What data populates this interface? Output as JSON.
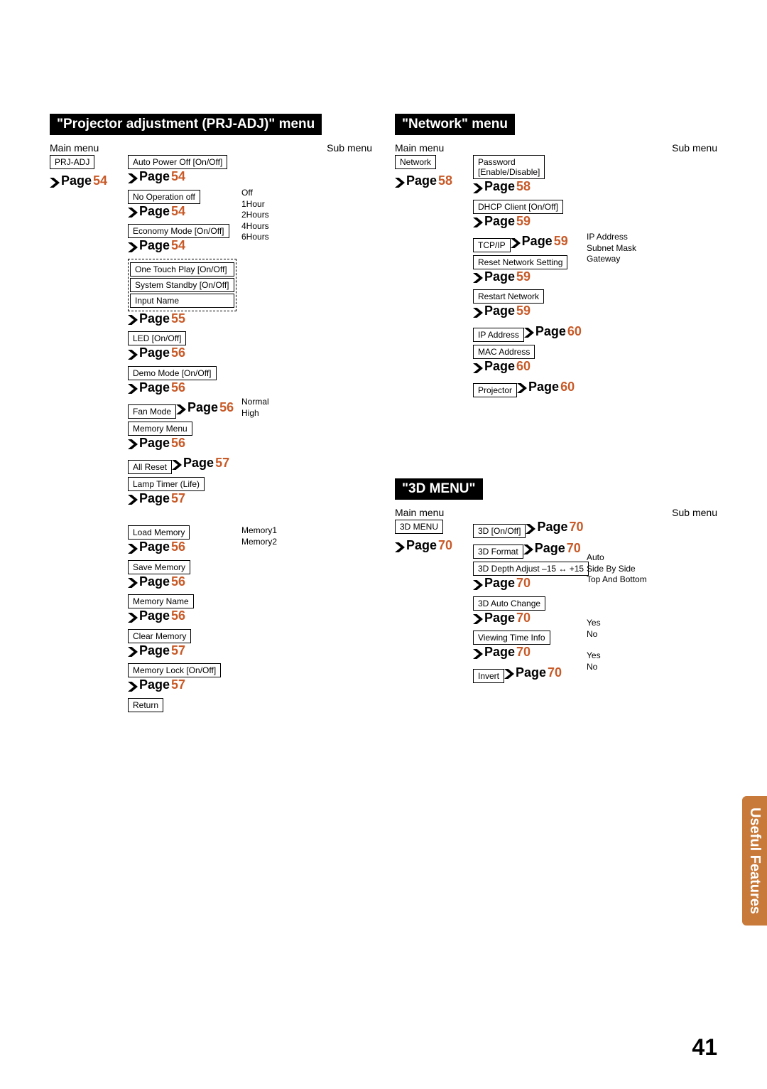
{
  "pageNumber": "41",
  "sideTab": "Useful\nFeatures",
  "prjAdj": {
    "title": "\"Projector adjustment (PRJ-ADJ)\" menu",
    "mainHeader": "Main menu",
    "subHeader": "Sub menu",
    "mainBox": "PRJ-ADJ",
    "mainPage": "54",
    "items": [
      {
        "box": "Auto Power Off [On/Off]",
        "page": "54"
      },
      {
        "box": "No Operation off",
        "page": "54",
        "sub": [
          "Off",
          "1Hour",
          "2Hours",
          "4Hours",
          "6Hours"
        ]
      },
      {
        "box": "Economy Mode [On/Off]",
        "page": "54"
      },
      {
        "dashed": [
          "One Touch Play [On/Off]",
          "System Standby [On/Off]",
          "Input Name"
        ],
        "page": "55"
      },
      {
        "box": "LED [On/Off]",
        "page": "56"
      },
      {
        "box": "Demo Mode [On/Off]",
        "page": "56"
      },
      {
        "box": "Fan Mode",
        "page": "56",
        "sub": [
          "Normal",
          "High"
        ]
      },
      {
        "box": "Memory Menu",
        "page": "56"
      },
      {
        "box": "All Reset",
        "page": "57"
      },
      {
        "box": "Lamp Timer (Life)",
        "page": "57"
      }
    ],
    "memoryItems": [
      {
        "box": "Load Memory",
        "page": "56",
        "sub": [
          "Memory1",
          "Memory2"
        ]
      },
      {
        "box": "Save Memory",
        "page": "56"
      },
      {
        "box": "Memory Name",
        "page": "56"
      },
      {
        "box": "Clear Memory",
        "page": "57"
      },
      {
        "box": "Memory Lock [On/Off]",
        "page": "57"
      },
      {
        "box": "Return",
        "page": ""
      }
    ]
  },
  "network": {
    "title": "\"Network\" menu",
    "mainHeader": "Main menu",
    "subHeader": "Sub menu",
    "mainBox": "Network",
    "mainPage": "58",
    "items": [
      {
        "box": "Password\n[Enable/Disable]",
        "page": "58"
      },
      {
        "box": "DHCP Client [On/Off]",
        "page": "59"
      },
      {
        "box": "TCP/IP",
        "page": "59",
        "sub": [
          "IP Address",
          "Subnet Mask",
          "Gateway"
        ]
      },
      {
        "box": "Reset Network Setting",
        "page": "59"
      },
      {
        "box": "Restart Network",
        "page": "59"
      },
      {
        "box": "IP Address",
        "page": "60"
      },
      {
        "box": "MAC Address",
        "page": "60"
      },
      {
        "box": "Projector",
        "page": "60"
      }
    ]
  },
  "menu3d": {
    "title": "\"3D MENU\"",
    "mainHeader": "Main menu",
    "subHeader": "Sub menu",
    "mainBox": "3D MENU",
    "mainPage": "70",
    "items": [
      {
        "box": "3D [On/Off]",
        "page": "70"
      },
      {
        "box": "3D Format",
        "page": "70",
        "sub": [
          "Auto",
          "Side By Side",
          "Top And Bottom"
        ]
      },
      {
        "box": "3D Depth Adjust  –15 ↔ +15",
        "page": "70"
      },
      {
        "box": "3D Auto Change",
        "page": "70",
        "sub": [
          "Yes",
          "No"
        ]
      },
      {
        "box": "Viewing Time Info",
        "page": "70",
        "sub": [
          "Yes",
          "No"
        ]
      },
      {
        "box": "Invert",
        "page": "70"
      }
    ]
  },
  "pageLabel": "Page "
}
